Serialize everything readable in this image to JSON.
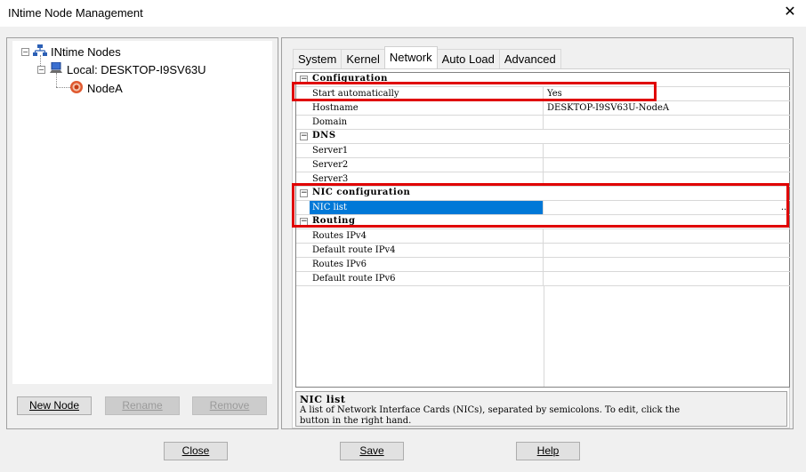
{
  "window": {
    "title": "INtime Node Management"
  },
  "tree": {
    "root": "INtime Nodes",
    "local": "Local: DESKTOP-I9SV63U",
    "node": "NodeA"
  },
  "left_buttons": {
    "new_node": "New Node",
    "rename": "Rename",
    "remove": "Remove"
  },
  "tabs": [
    "System",
    "Kernel",
    "Network",
    "Auto Load",
    "Advanced"
  ],
  "active_tab": "Network",
  "grid": {
    "configuration": {
      "label": "Configuration",
      "start_automatically": {
        "name": "Start automatically",
        "value": "Yes"
      },
      "hostname": {
        "name": "Hostname",
        "value": "DESKTOP-I9SV63U-NodeA"
      },
      "domain": {
        "name": "Domain",
        "value": ""
      }
    },
    "dns": {
      "label": "DNS",
      "server1": {
        "name": "Server1",
        "value": ""
      },
      "server2": {
        "name": "Server2",
        "value": ""
      },
      "server3": {
        "name": "Server3",
        "value": ""
      }
    },
    "nic": {
      "label": "NIC configuration",
      "nic_list": {
        "name": "NIC list",
        "value": ""
      },
      "ellipsis": ".."
    },
    "routing": {
      "label": "Routing",
      "routes_ipv4": {
        "name": "Routes IPv4",
        "value": ""
      },
      "default_route_ipv4": {
        "name": "Default route IPv4",
        "value": ""
      },
      "routes_ipv6": {
        "name": "Routes IPv6",
        "value": ""
      },
      "default_route_ipv6": {
        "name": "Default route IPv6",
        "value": ""
      }
    }
  },
  "description": {
    "title": "NIC list",
    "line1": "A list of Network Interface Cards (NICs), separated by semicolons. To edit, click the",
    "line2": "button in the right hand."
  },
  "bottom_buttons": {
    "close": "Close",
    "save": "Save",
    "help": "Help"
  },
  "colors": {
    "highlight": "#e00000",
    "selection": "#0078d7"
  }
}
